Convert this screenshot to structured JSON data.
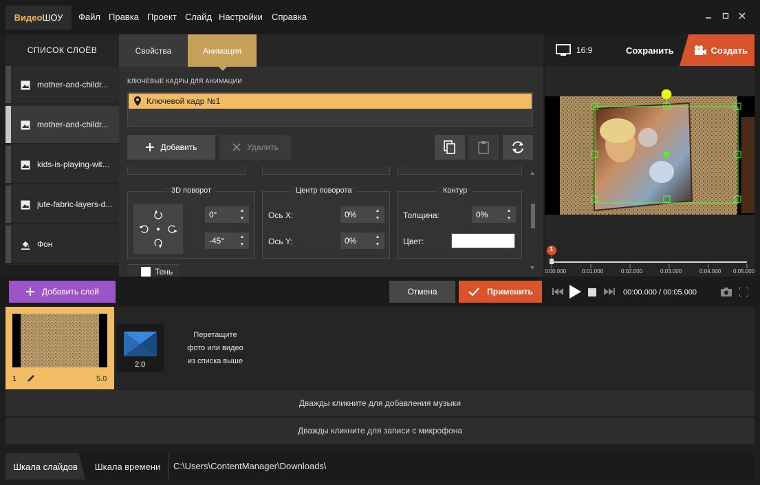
{
  "app": {
    "logo_a": "Видео",
    "logo_b": "ШОУ"
  },
  "menu": [
    "Файл",
    "Правка",
    "Проект",
    "Слайд",
    "Настройки",
    "Справка"
  ],
  "layers": {
    "title": "СПИСОК СЛОЁВ",
    "items": [
      {
        "label": "mother-and-childr...",
        "icon": "image-icon"
      },
      {
        "label": "mother-and-childr...",
        "icon": "image-icon"
      },
      {
        "label": "kids-is-playing-wit...",
        "icon": "image-icon"
      },
      {
        "label": "jute-fabric-layers-d...",
        "icon": "image-icon"
      },
      {
        "label": "Фон",
        "icon": "paint-bucket-icon"
      }
    ]
  },
  "props": {
    "tabs": [
      "Свойства",
      "Анимация"
    ],
    "keyframes_title": "КЛЮЧЕВЫЕ КАДРЫ ДЛЯ АНИМАЦИИ",
    "keyframe": "Ключевой кадр №1",
    "add_label": "Добавить",
    "delete_label": "Удалить",
    "rotation3d": {
      "title": "3D поворот",
      "value1": "0°",
      "value2": "-45°"
    },
    "center": {
      "title": "Центр поворота",
      "x_label": "Ось X:",
      "x_value": "0%",
      "y_label": "Ось Y:",
      "y_value": "0%"
    },
    "contour": {
      "title": "Контур",
      "thickness_label": "Толщина:",
      "thickness_value": "0%",
      "color_label": "Цвет:",
      "color_value": "#ffffff"
    },
    "shadow_label": "Тень"
  },
  "preview": {
    "ratio": "16:9",
    "save": "Сохранить",
    "create": "Создать",
    "marker": "1",
    "ticks": [
      "0:00.000",
      "0:01.000",
      "0:02.000",
      "0:03.000",
      "0:04.000",
      "0:05.000"
    ]
  },
  "controls": {
    "add_layer": "Добавить слой",
    "cancel": "Отмена",
    "apply": "Применить",
    "time_current": "00:00.000",
    "time_sep": " / ",
    "time_total": "00:05.000"
  },
  "slides": {
    "slide_number": "1",
    "slide_duration": "5.0",
    "transition_duration": "2.0",
    "drop_hint_1": "Перетащите",
    "drop_hint_2": "фото или видео",
    "drop_hint_3": "из списка выше"
  },
  "tracks": {
    "music": "Дважды кликните для добавления музыки",
    "mic": "Дважды кликните для записи с микрофона"
  },
  "statusbar": {
    "slides_tab": "Шкала слайдов",
    "timeline_tab": "Шкала времени",
    "path": "C:\\Users\\ContentManager\\Downloads\\"
  },
  "colors": {
    "accent": "#f2bc64",
    "create": "#d9532b",
    "add_layer": "#9b55c8"
  }
}
